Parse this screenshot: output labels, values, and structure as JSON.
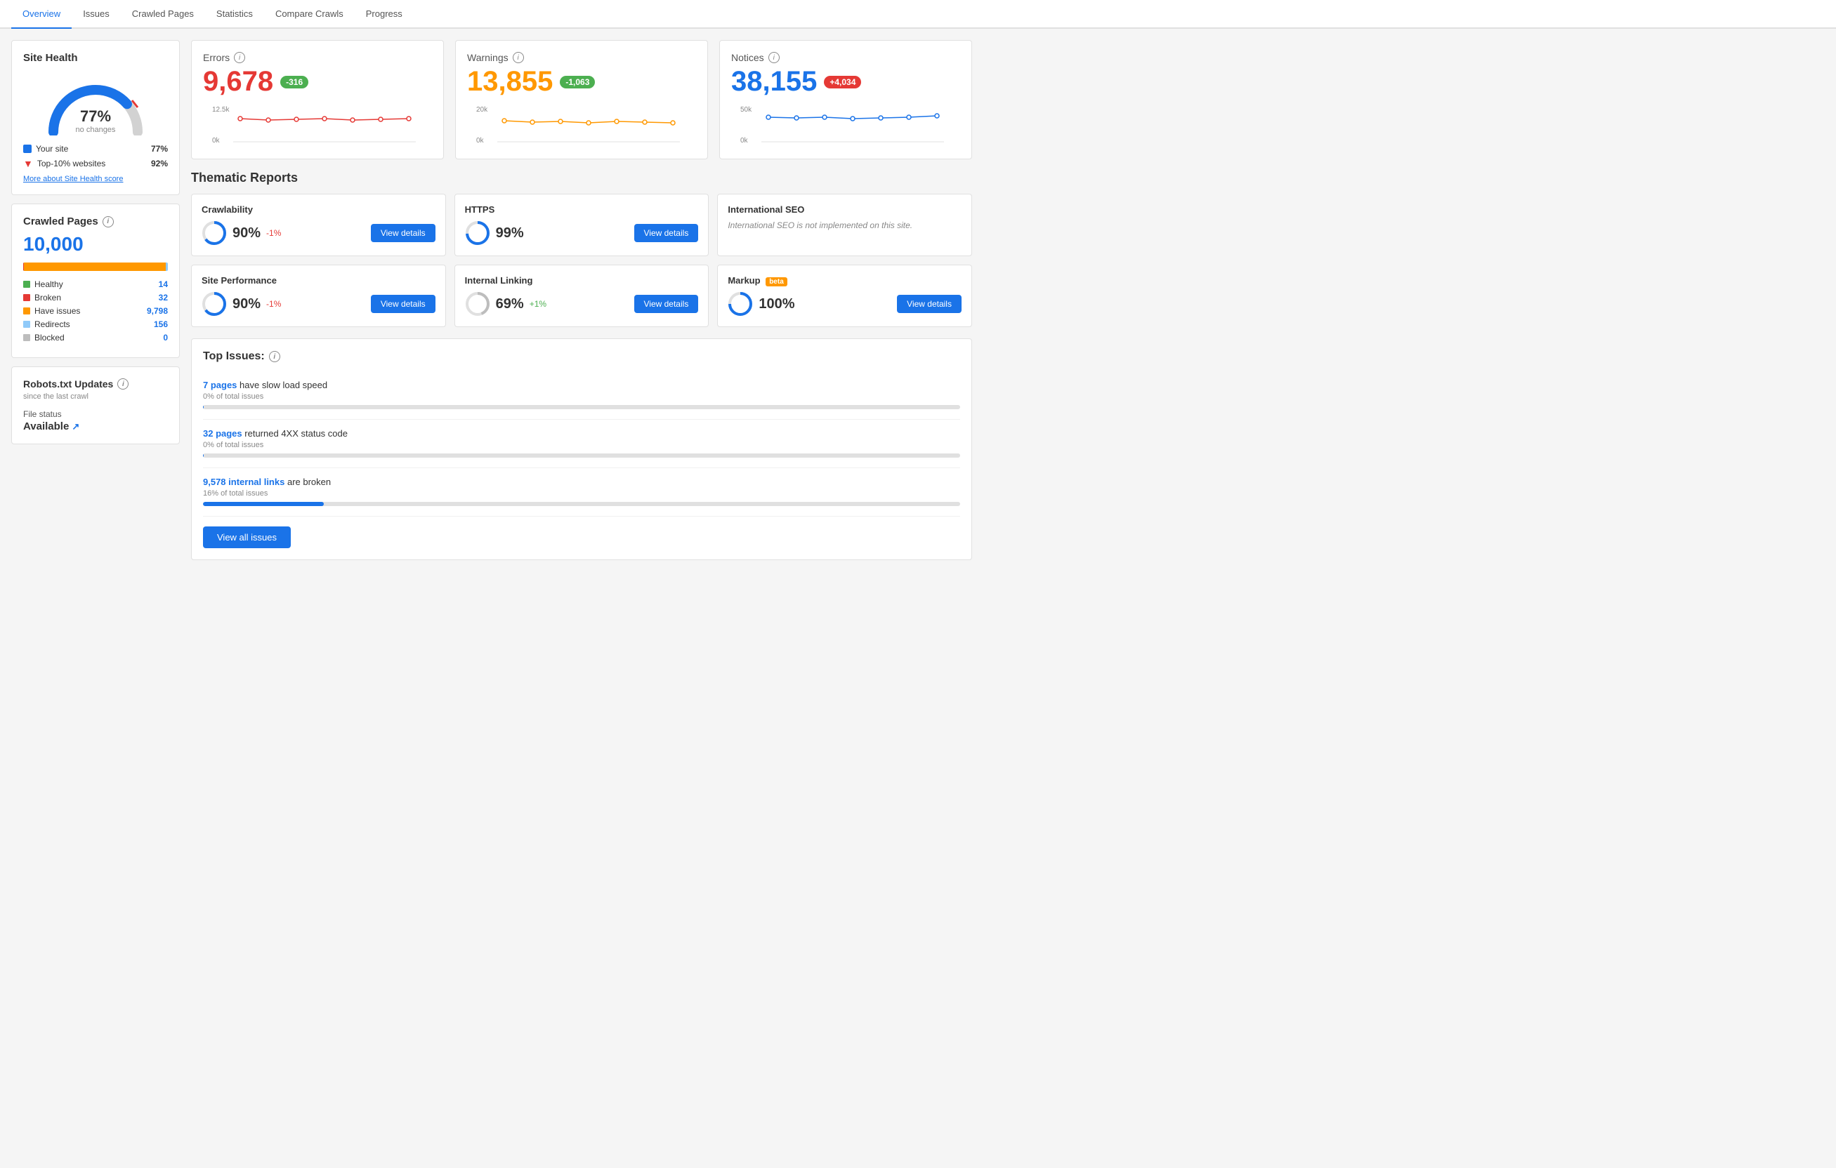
{
  "tabs": [
    {
      "label": "Overview",
      "active": true
    },
    {
      "label": "Issues",
      "active": false
    },
    {
      "label": "Crawled Pages",
      "active": false
    },
    {
      "label": "Statistics",
      "active": false
    },
    {
      "label": "Compare Crawls",
      "active": false
    },
    {
      "label": "Progress",
      "active": false
    }
  ],
  "siteHealth": {
    "title": "Site Health",
    "percent": "77%",
    "sublabel": "no changes",
    "legend": [
      {
        "label": "Your site",
        "value": "77%",
        "color": "blue"
      },
      {
        "label": "Top-10% websites",
        "value": "92%",
        "color": "red-arrow"
      }
    ],
    "moreLink": "More about Site Health score"
  },
  "crawledPages": {
    "title": "Crawled Pages",
    "count": "10,000",
    "stats": [
      {
        "label": "Healthy",
        "value": "14",
        "color": "green"
      },
      {
        "label": "Broken",
        "value": "32",
        "color": "red"
      },
      {
        "label": "Have issues",
        "value": "9,798",
        "color": "orange"
      },
      {
        "label": "Redirects",
        "value": "156",
        "color": "blue-light"
      },
      {
        "label": "Blocked",
        "value": "0",
        "color": "gray"
      }
    ]
  },
  "robotsTxt": {
    "title": "Robots.txt Updates",
    "subtitle": "since the last crawl",
    "fileStatusLabel": "File status",
    "fileStatusValue": "Available"
  },
  "errors": {
    "title": "Errors",
    "value": "9,678",
    "badge": "-316",
    "badgeType": "neg",
    "chartMax": "12.5k",
    "chartMin": "0k"
  },
  "warnings": {
    "title": "Warnings",
    "value": "13,855",
    "badge": "-1,063",
    "badgeType": "neg",
    "chartMax": "20k",
    "chartMin": "0k"
  },
  "notices": {
    "title": "Notices",
    "value": "38,155",
    "badge": "+4,034",
    "badgeType": "pos",
    "chartMax": "50k",
    "chartMin": "0k"
  },
  "thematicReports": {
    "title": "Thematic Reports",
    "reports": [
      {
        "id": "crawlability",
        "title": "Crawlability",
        "score": "90%",
        "change": "-1%",
        "changeType": "neg",
        "hasDetails": true
      },
      {
        "id": "https",
        "title": "HTTPS",
        "score": "99%",
        "change": "",
        "changeType": "",
        "hasDetails": true
      },
      {
        "id": "international-seo",
        "title": "International SEO",
        "score": "",
        "change": "",
        "changeType": "",
        "hasDetails": false,
        "naText": "International SEO is not implemented on this site."
      },
      {
        "id": "site-performance",
        "title": "Site Performance",
        "score": "90%",
        "change": "-1%",
        "changeType": "neg",
        "hasDetails": true
      },
      {
        "id": "internal-linking",
        "title": "Internal Linking",
        "score": "69%",
        "change": "+1%",
        "changeType": "pos",
        "hasDetails": true
      },
      {
        "id": "markup",
        "title": "Markup",
        "score": "100%",
        "change": "",
        "changeType": "",
        "hasDetails": true,
        "beta": true
      }
    ],
    "viewDetailsLabel": "View details"
  },
  "topIssues": {
    "title": "Top Issues:",
    "issues": [
      {
        "linkText": "7 pages",
        "text": "have slow load speed",
        "pct": "0% of total issues",
        "progressClass": "p0"
      },
      {
        "linkText": "32 pages",
        "text": "returned 4XX status code",
        "pct": "0% of total issues",
        "progressClass": "p0"
      },
      {
        "linkText": "9,578 internal links",
        "text": "are broken",
        "pct": "16% of total issues",
        "progressClass": "p16"
      }
    ],
    "viewAllLabel": "View all issues"
  }
}
